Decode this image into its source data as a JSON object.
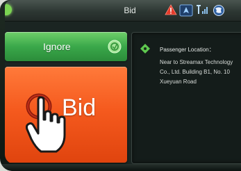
{
  "status_bar": {
    "title": "Bid",
    "icons": [
      "home-icon",
      "warning-icon",
      "navigation-icon",
      "signal-icon",
      "globe-icon"
    ],
    "colors": {
      "home": "#7bd452",
      "warning": "#e43a2a",
      "nav": "#3a7fd4"
    }
  },
  "actions": {
    "ignore_label": "Ignore",
    "bid_label": "Bid"
  },
  "info": {
    "title": "Passenger Location：",
    "address_lines": [
      "Near to Streamax Technology",
      "Co., Ltd. Building B1, No. 10",
      "Xueyuan Road"
    ]
  },
  "colors": {
    "ignore": "#3aa84a",
    "bid": "#f55a1e",
    "panel": "#141c1a"
  }
}
